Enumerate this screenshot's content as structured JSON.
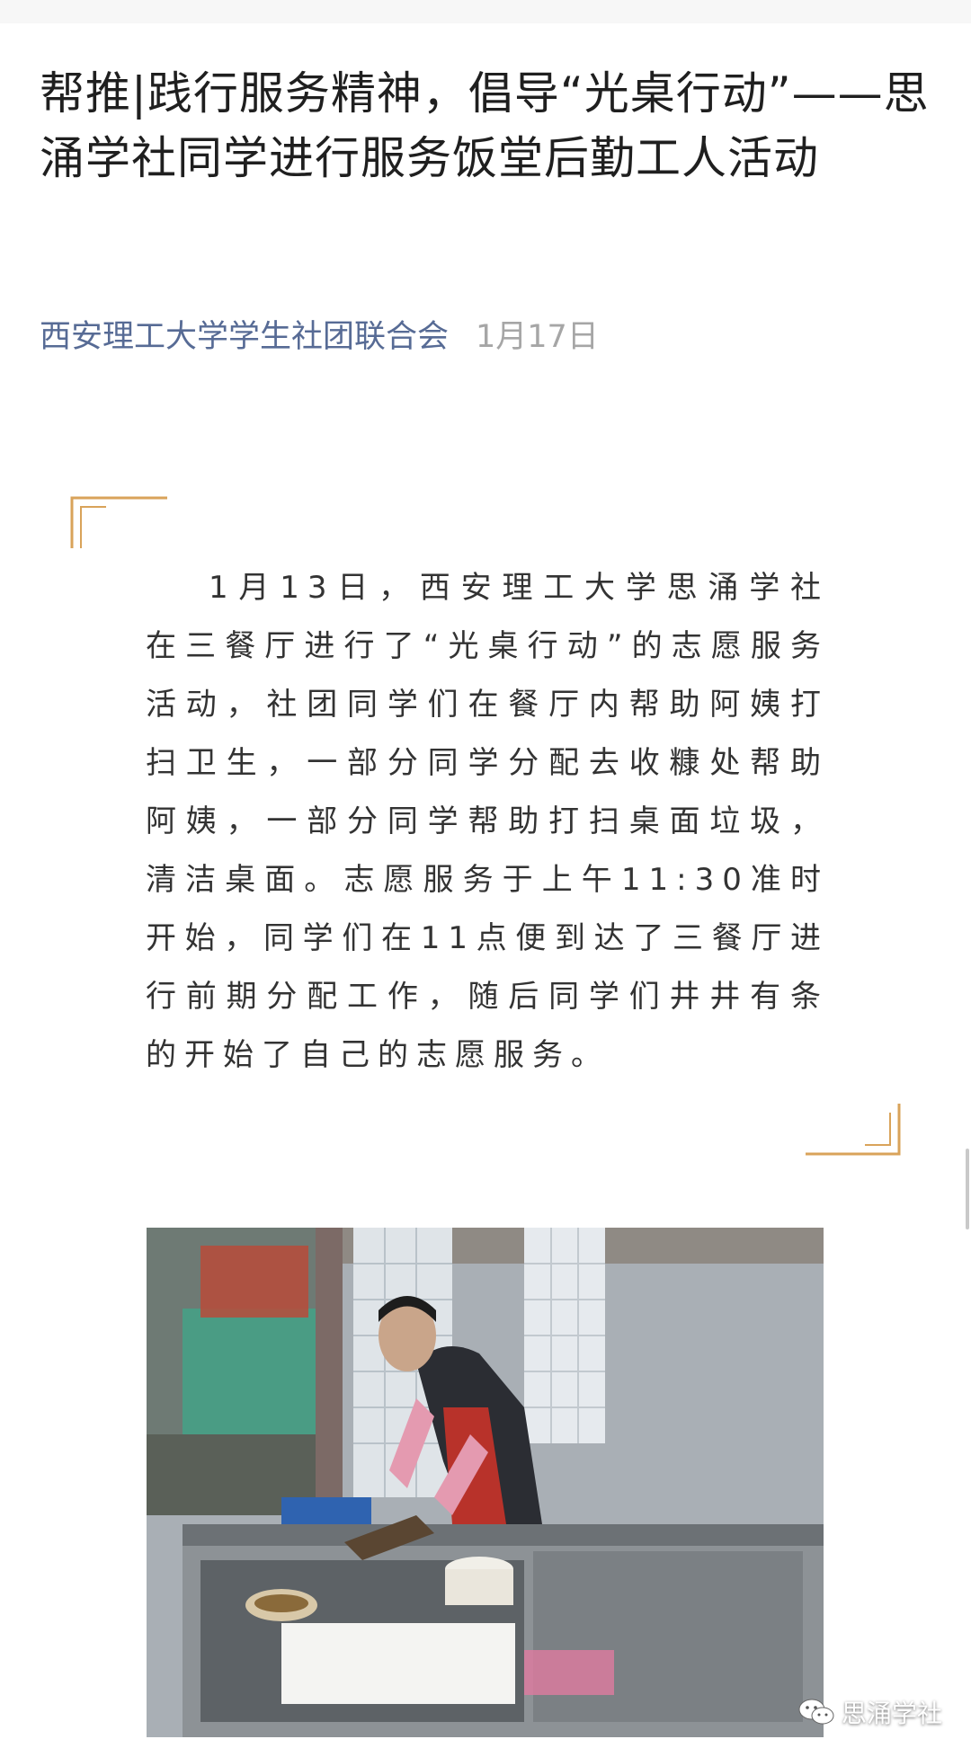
{
  "article": {
    "title": "帮推|践行服务精神，倡导“光桌行动”——思涌学社同学进行服务饭堂后勤工人活动",
    "author": "西安理工大学学生社团联合会",
    "date": "1月17日",
    "body": "1月13日，西安理工大学思涌学社在三餐厅进行了“光桌行动”的志愿服务活动，社团同学们在餐厅内帮助阿姨打扫卫生，一部分同学分配去收糠处帮助阿姨，一部分同学帮助打扫桌面垃圾，清洁桌面。志愿服务于上午11:30准时开始，同学们在11点便到达了三餐厅进行前期分配工作，随后同学们井井有条的开始了自己的志愿服务。"
  },
  "watermark": {
    "text": "思涌学社",
    "icon": "wechat-icon"
  },
  "colors": {
    "accent": "#d9a35a",
    "author": "#576b95",
    "date": "#a6a6a6"
  }
}
